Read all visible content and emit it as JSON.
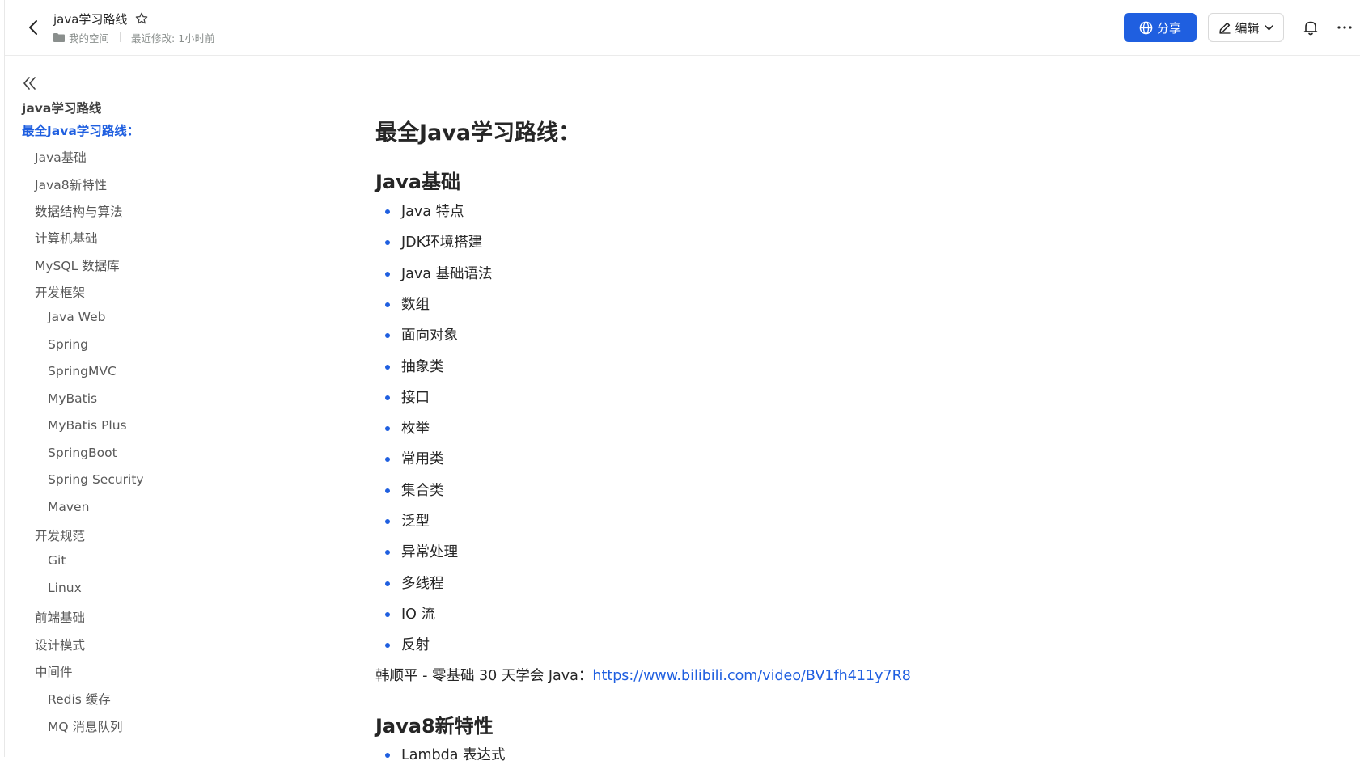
{
  "header": {
    "title": "java学习路线",
    "breadcrumb_space": "我的空间",
    "last_modified": "最近修改: 1小时前",
    "share_label": "分享",
    "edit_label": "编辑",
    "accent_color": "#1f5fe0"
  },
  "toc": {
    "items": [
      {
        "label": "java学习路线",
        "level": 0,
        "style": "title"
      },
      {
        "label": "最全Java学习路线：",
        "level": 0,
        "style": "active"
      },
      {
        "label": "Java基础",
        "level": 1
      },
      {
        "label": "Java8新特性",
        "level": 1
      },
      {
        "label": "数据结构与算法",
        "level": 1
      },
      {
        "label": "计算机基础",
        "level": 1
      },
      {
        "label": "MySQL 数据库",
        "level": 1
      },
      {
        "label": "开发框架",
        "level": 1
      },
      {
        "label": "Java Web",
        "level": 2
      },
      {
        "label": "Spring",
        "level": 2
      },
      {
        "label": "SpringMVC",
        "level": 2
      },
      {
        "label": "MyBatis",
        "level": 2
      },
      {
        "label": "MyBatis Plus",
        "level": 2
      },
      {
        "label": "SpringBoot",
        "level": 2
      },
      {
        "label": "Spring Security",
        "level": 2
      },
      {
        "label": "Maven",
        "level": 2
      },
      {
        "label": "开发规范",
        "level": 1
      },
      {
        "label": "Git",
        "level": 2
      },
      {
        "label": "Linux",
        "level": 2
      },
      {
        "label": "前端基础",
        "level": 1
      },
      {
        "label": "设计模式",
        "level": 1
      },
      {
        "label": "中间件",
        "level": 1
      },
      {
        "label": "Redis 缓存",
        "level": 2
      },
      {
        "label": "MQ 消息队列",
        "level": 2
      }
    ]
  },
  "content": {
    "heading": "最全Java学习路线：",
    "section1": {
      "title": "Java基础",
      "items": [
        "Java 特点",
        "JDK环境搭建",
        "Java 基础语法",
        "数组",
        "面向对象",
        "抽象类",
        "接口",
        "枚举",
        "常用类",
        "集合类",
        "泛型",
        "异常处理",
        "多线程",
        "IO 流",
        "反射"
      ],
      "note_prefix": "韩顺平 - 零基础 30 天学会 Java：",
      "note_link": "https://www.bilibili.com/video/BV1fh411y7R8"
    },
    "section2": {
      "title": "Java8新特性",
      "items": [
        "Lambda 表达式"
      ]
    }
  }
}
